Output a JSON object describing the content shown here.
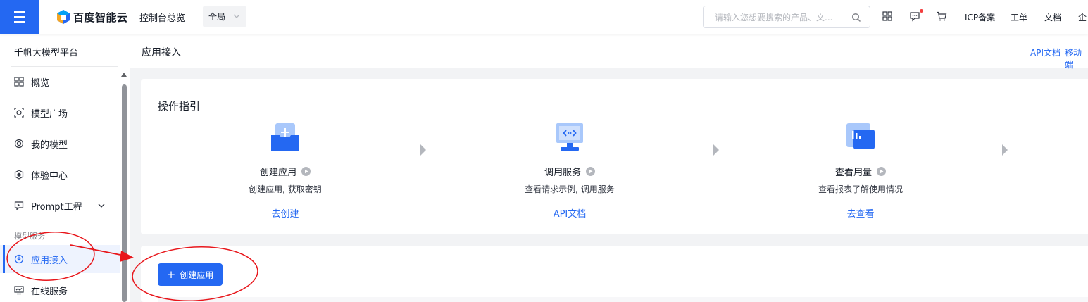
{
  "topbar": {
    "logo_text": "百度智能云",
    "console_link": "控制台总览",
    "region": "全局",
    "search_placeholder": "请输入您想要搜索的产品、文...",
    "links": {
      "icp": "ICP备案",
      "ticket": "工单",
      "docs": "文档",
      "enterprise": "企"
    },
    "icons": [
      "apps-grid-icon",
      "message-icon",
      "cart-icon"
    ]
  },
  "sidebar": {
    "title": "千帆大模型平台",
    "items": [
      {
        "label": "概览",
        "icon": "grid-icon"
      },
      {
        "label": "模型广场",
        "icon": "model-square-icon"
      },
      {
        "label": "我的模型",
        "icon": "my-model-icon"
      },
      {
        "label": "体验中心",
        "icon": "experience-icon"
      },
      {
        "label": "Prompt工程",
        "icon": "prompt-icon"
      }
    ],
    "group_label": "模型服务",
    "service_items": [
      {
        "label": "应用接入",
        "icon": "app-access-icon",
        "active": true
      },
      {
        "label": "在线服务",
        "icon": "online-service-icon"
      }
    ]
  },
  "main": {
    "page_title": "应用接入",
    "header_links": {
      "api_doc": "API文档",
      "mobile": "移动端"
    },
    "guide": {
      "title": "操作指引",
      "steps": [
        {
          "name": "创建应用",
          "desc": "创建应用, 获取密钥",
          "link": "去创建"
        },
        {
          "name": "调用服务",
          "desc": "查看请求示例, 调用服务",
          "link": "API文档"
        },
        {
          "name": "查看用量",
          "desc": "查看报表了解使用情况",
          "link": "去查看"
        }
      ]
    },
    "create_button": {
      "icon": "+",
      "label": "创建应用"
    }
  },
  "colors": {
    "accent": "#2468f2",
    "annotation": "#e8161b",
    "notification_dot": "#f33e3e"
  }
}
